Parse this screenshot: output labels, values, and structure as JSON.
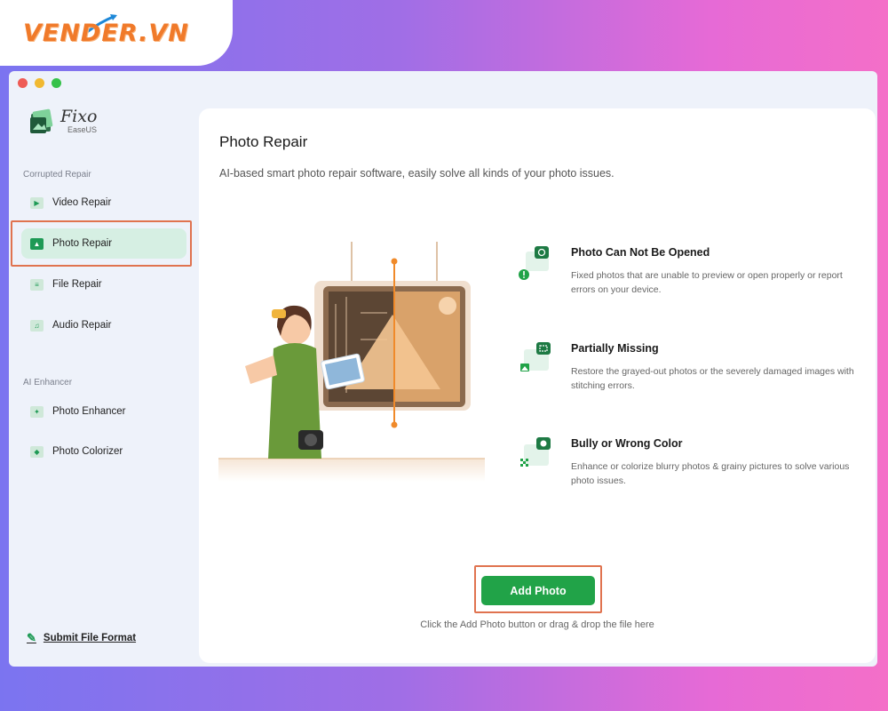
{
  "watermark": {
    "logo_text": "VENDER.VN"
  },
  "window": {
    "app": {
      "name": "Fixo",
      "vendor": "EaseUS"
    },
    "sidebar": {
      "sections": [
        {
          "label": "Corrupted Repair"
        },
        {
          "label": "AI Enhancer"
        }
      ],
      "items": [
        {
          "label": "Video Repair",
          "icon": "video-icon",
          "active": false
        },
        {
          "label": "Photo Repair",
          "icon": "photo-icon",
          "active": true
        },
        {
          "label": "File Repair",
          "icon": "file-icon",
          "active": false
        },
        {
          "label": "Audio Repair",
          "icon": "audio-icon",
          "active": false
        },
        {
          "label": "Photo Enhancer",
          "icon": "photo-enhancer-icon",
          "active": false
        },
        {
          "label": "Photo Colorizer",
          "icon": "photo-colorizer-icon",
          "active": false
        }
      ],
      "submit_link": "Submit File Format"
    },
    "main": {
      "title": "Photo Repair",
      "description": "AI-based smart photo repair software, easily solve all kinds of your photo issues.",
      "features": [
        {
          "title": "Photo Can Not Be Opened",
          "description": "Fixed photos that are unable to preview or open properly or report errors on your device."
        },
        {
          "title": "Partially Missing",
          "description": "Restore the grayed-out photos or the severely damaged images with stitching errors."
        },
        {
          "title": "Bully or Wrong Color",
          "description": "Enhance or colorize blurry photos & grainy pictures to solve various photo issues."
        }
      ],
      "add_button": "Add Photo",
      "hint": "Click the Add Photo button or drag & drop the file here"
    },
    "colors": {
      "accent": "#21a348",
      "highlight": "#e0734f",
      "active_bg": "#d6efe3"
    }
  }
}
